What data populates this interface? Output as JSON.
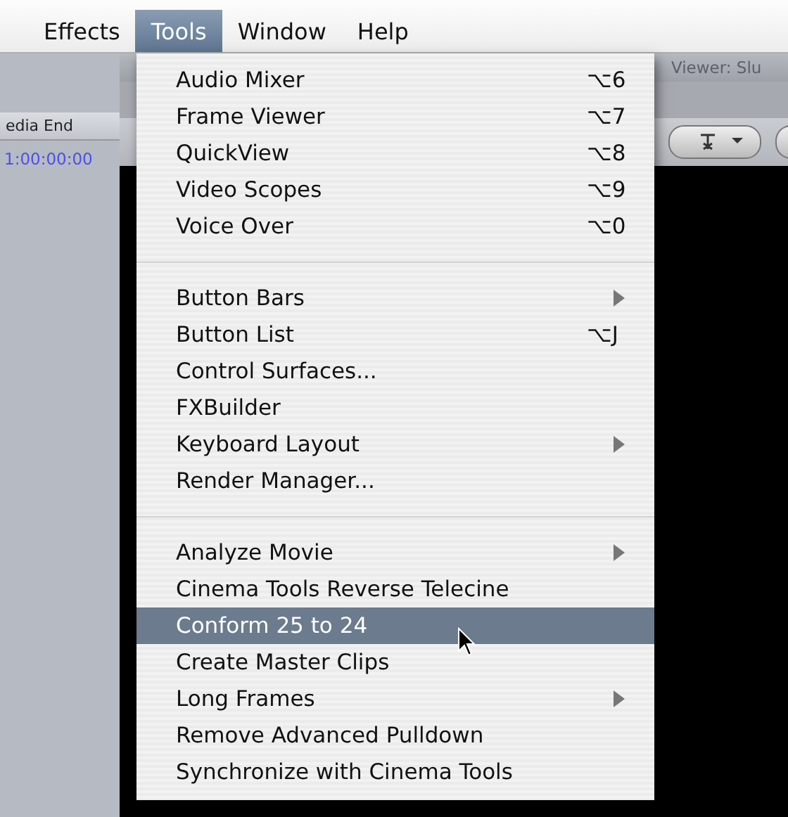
{
  "menubar": {
    "items": [
      {
        "label": "Effects",
        "selected": false
      },
      {
        "label": "Tools",
        "selected": true
      },
      {
        "label": "Window",
        "selected": false
      },
      {
        "label": "Help",
        "selected": false
      }
    ]
  },
  "browser_panel": {
    "column_header": "edia End",
    "timecode": "1:00:00:00"
  },
  "viewer": {
    "title": "Viewer: Slu"
  },
  "menu": {
    "groups": [
      [
        {
          "label": "Audio Mixer",
          "shortcut": "⌥6",
          "submenu": false,
          "selected": false
        },
        {
          "label": "Frame Viewer",
          "shortcut": "⌥7",
          "submenu": false,
          "selected": false
        },
        {
          "label": "QuickView",
          "shortcut": "⌥8",
          "submenu": false,
          "selected": false
        },
        {
          "label": "Video Scopes",
          "shortcut": "⌥9",
          "submenu": false,
          "selected": false
        },
        {
          "label": "Voice Over",
          "shortcut": "⌥0",
          "submenu": false,
          "selected": false
        }
      ],
      [
        {
          "label": "Button Bars",
          "submenu": true,
          "selected": false
        },
        {
          "label": "Button List",
          "shortcut": "⌥J",
          "submenu": false,
          "selected": false
        },
        {
          "label": "Control Surfaces...",
          "submenu": false,
          "selected": false
        },
        {
          "label": "FXBuilder",
          "submenu": false,
          "selected": false
        },
        {
          "label": "Keyboard Layout",
          "submenu": true,
          "selected": false
        },
        {
          "label": "Render Manager...",
          "submenu": false,
          "selected": false
        }
      ],
      [
        {
          "label": "Analyze Movie",
          "submenu": true,
          "selected": false
        },
        {
          "label": "Cinema Tools Reverse Telecine",
          "submenu": false,
          "selected": false
        },
        {
          "label": "Conform 25 to 24",
          "submenu": false,
          "selected": true
        },
        {
          "label": "Create Master Clips",
          "submenu": false,
          "selected": false
        },
        {
          "label": "Long Frames",
          "submenu": true,
          "selected": false
        },
        {
          "label": "Remove Advanced Pulldown",
          "submenu": false,
          "selected": false
        },
        {
          "label": "Synchronize with Cinema Tools",
          "submenu": false,
          "selected": false
        }
      ]
    ]
  }
}
